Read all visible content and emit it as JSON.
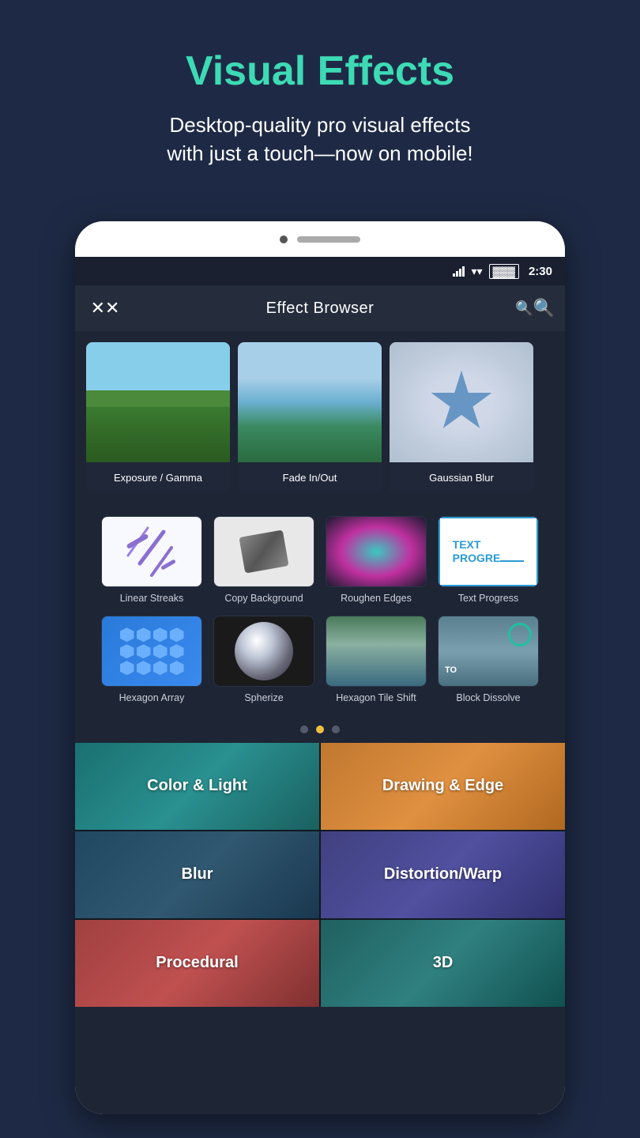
{
  "header": {
    "title": "Visual Effects",
    "subtitle": "Desktop-quality pro visual effects\nwith just a touch—now on mobile!"
  },
  "screen": {
    "status_bar": {
      "time": "2:30"
    },
    "top_bar": {
      "title": "Effect Browser",
      "close_label": "✕",
      "search_label": "🔍"
    },
    "horizontal_effects": [
      {
        "name": "Exposure / Gamma",
        "type": "exposure"
      },
      {
        "name": "Fade In/Out",
        "type": "fade"
      },
      {
        "name": "Gaussian Blur",
        "type": "gaussian"
      }
    ],
    "grid_effects_row1": [
      {
        "name": "Linear Streaks",
        "type": "linear"
      },
      {
        "name": "Copy Background",
        "type": "copy"
      },
      {
        "name": "Roughen Edges",
        "type": "roughen"
      },
      {
        "name": "Text Progress",
        "type": "text"
      }
    ],
    "grid_effects_row2": [
      {
        "name": "Hexagon Array",
        "type": "hexarray"
      },
      {
        "name": "Spherize",
        "type": "spherize"
      },
      {
        "name": "Hexagon Tile Shift",
        "type": "hexshift"
      },
      {
        "name": "Block Dissolve",
        "type": "blockdissolve"
      }
    ],
    "pagination": {
      "dots": [
        "inactive",
        "active",
        "inactive"
      ],
      "colors": {
        "inactive": "#555a6a",
        "active": "#f0c040"
      }
    },
    "categories": [
      {
        "label": "Color & Light",
        "style": "cat-color-light"
      },
      {
        "label": "Drawing & Edge",
        "style": "cat-drawing"
      },
      {
        "label": "Blur",
        "style": "cat-blur"
      },
      {
        "label": "Distortion/Warp",
        "style": "cat-distortion"
      },
      {
        "label": "Procedural",
        "style": "cat-procedural"
      },
      {
        "label": "3D",
        "style": "cat-3d"
      }
    ]
  }
}
